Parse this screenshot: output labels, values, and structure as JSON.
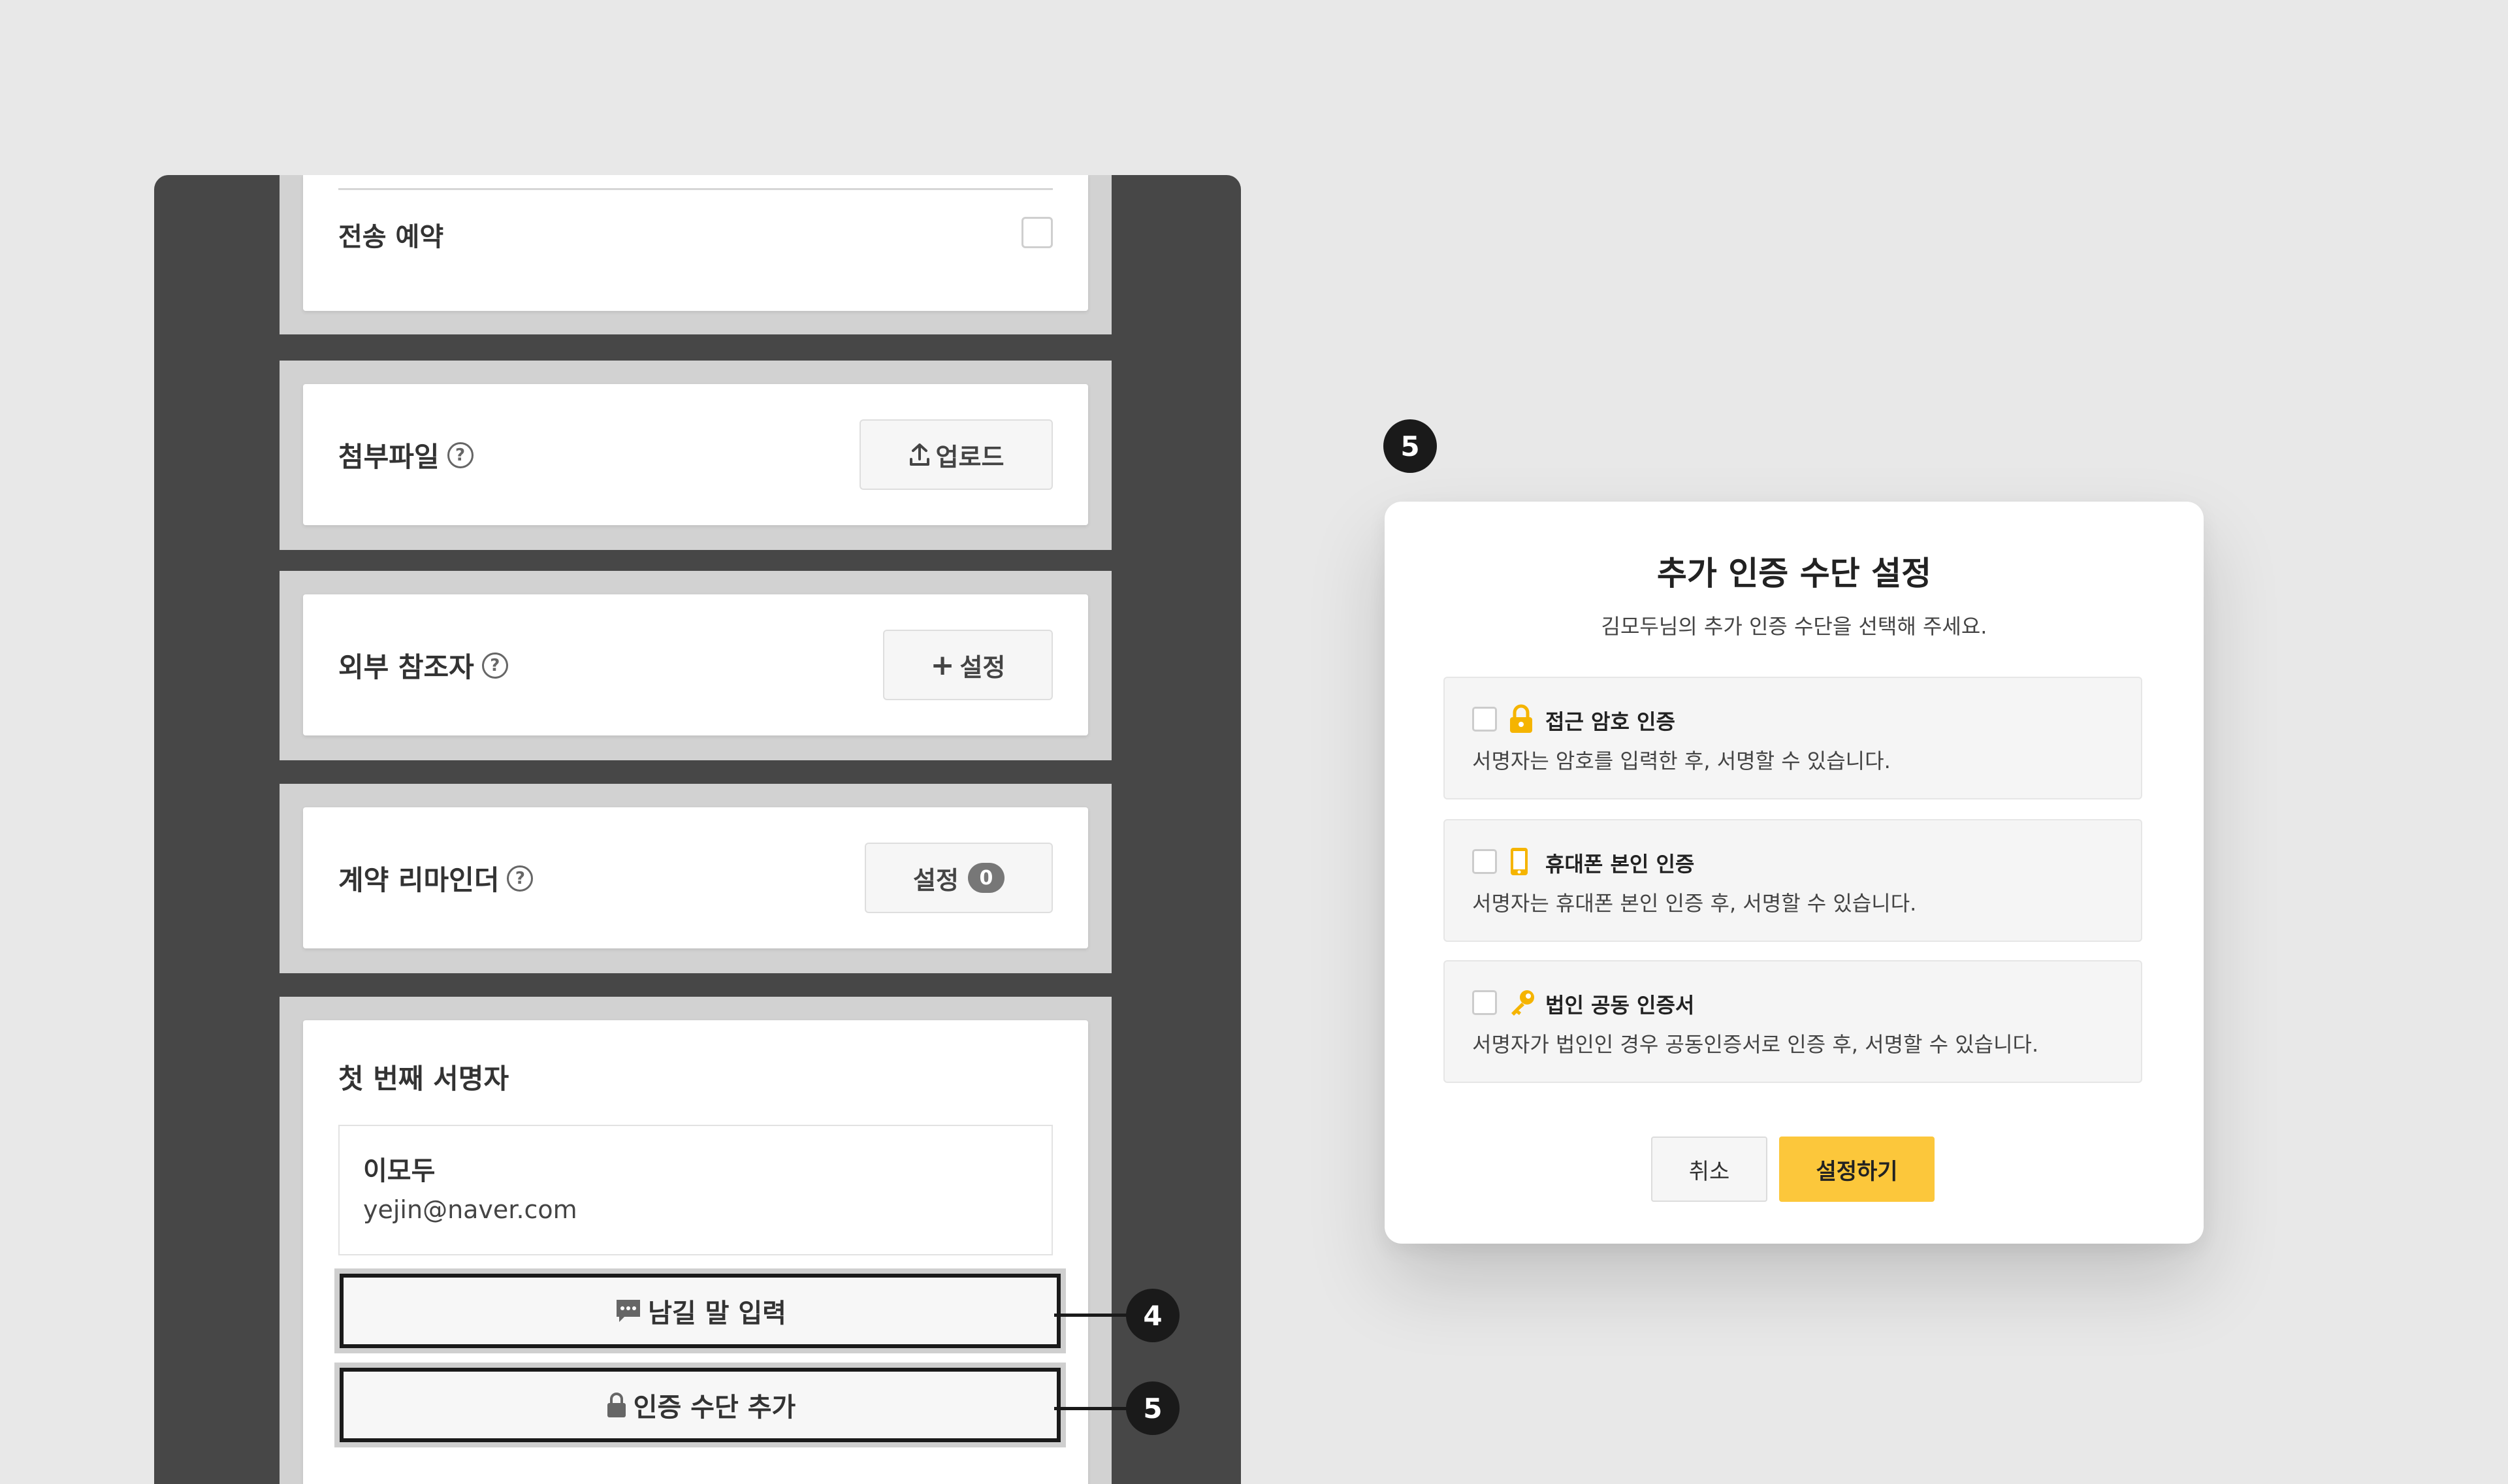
{
  "form": {
    "schedule_label": "전송 예약",
    "attachment_label": "첨부파일",
    "upload_label": "업로드",
    "external_ref_label": "외부 참조자",
    "external_ref_button": "설정",
    "reminder_label": "계약 리마인더",
    "reminder_button": "설정",
    "reminder_count": "0",
    "help_glyph": "?",
    "plus_glyph": "+",
    "first_signer_title": "첫 번째 서명자",
    "signer_name": "이모두",
    "signer_email": "yejin@naver.com",
    "message_button": "남길 말 입력",
    "auth_button": "인증 수단 추가"
  },
  "callouts": {
    "message_step": "4",
    "auth_step": "5",
    "modal_step": "5"
  },
  "modal": {
    "title": "추가 인증 수단 설정",
    "subtitle": "김모두님의 추가 인증 수단을 선택해 주세요.",
    "options": [
      {
        "icon": "lock-icon",
        "title": "접근 암호 인증",
        "description": "서명자는 암호를 입력한 후, 서명할 수 있습니다."
      },
      {
        "icon": "phone-icon",
        "title": "휴대폰 본인 인증",
        "description": "서명자는 휴대폰 본인 인증 후, 서명할 수 있습니다."
      },
      {
        "icon": "key-icon",
        "title": "법인 공동 인증서",
        "description": "서명자가 법인인 경우 공동인증서로 인증 후, 서명할 수 있습니다."
      }
    ],
    "cancel_label": "취소",
    "confirm_label": "설정하기"
  },
  "colors": {
    "accent": "#fcc73b",
    "icon_gold": "#f5b400",
    "panel_dark": "#474747",
    "page_bg": "#e8e8e8"
  }
}
